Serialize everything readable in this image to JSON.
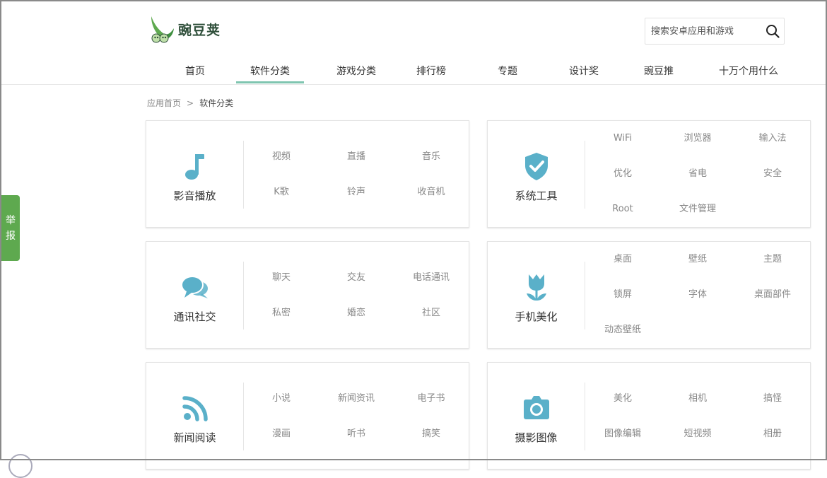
{
  "brand": {
    "name": "豌豆荚",
    "color": "#5ea94f"
  },
  "search": {
    "placeholder": "搜索安卓应用和游戏",
    "value": ""
  },
  "nav": {
    "active_color": "#7fc5b0",
    "items": [
      {
        "label": "首页",
        "active": false
      },
      {
        "label": "软件分类",
        "active": true
      },
      {
        "label": "游戏分类",
        "active": false
      },
      {
        "label": "排行榜",
        "active": false
      },
      {
        "label": "专题",
        "active": false
      },
      {
        "label": "设计奖",
        "active": false
      },
      {
        "label": "豌豆推",
        "active": false
      },
      {
        "label": "十万个用什么",
        "active": false
      }
    ]
  },
  "report": {
    "line1": "举",
    "line2": "报",
    "color": "#5ea94f"
  },
  "breadcrumb": {
    "home": "应用首页",
    "separator": ">",
    "current": "软件分类"
  },
  "icon_color": "#5ab0c9",
  "categories": [
    {
      "title": "影音播放",
      "icon": "music-note-icon",
      "items": [
        "视频",
        "直播",
        "音乐",
        "K歌",
        "铃声",
        "收音机"
      ]
    },
    {
      "title": "系统工具",
      "icon": "shield-check-icon",
      "items": [
        "WiFi",
        "浏览器",
        "输入法",
        "优化",
        "省电",
        "安全",
        "Root",
        "文件管理"
      ]
    },
    {
      "title": "通讯社交",
      "icon": "chat-bubbles-icon",
      "items": [
        "聊天",
        "交友",
        "电话通讯",
        "私密",
        "婚恋",
        "社区"
      ]
    },
    {
      "title": "手机美化",
      "icon": "tulip-icon",
      "items": [
        "桌面",
        "壁纸",
        "主题",
        "锁屏",
        "字体",
        "桌面部件",
        "动态壁纸"
      ]
    },
    {
      "title": "新闻阅读",
      "icon": "rss-icon",
      "items": [
        "小说",
        "新闻资讯",
        "电子书",
        "漫画",
        "听书",
        "搞笑"
      ]
    },
    {
      "title": "摄影图像",
      "icon": "camera-icon",
      "items": [
        "美化",
        "相机",
        "搞怪",
        "图像编辑",
        "短视频",
        "相册"
      ]
    }
  ]
}
